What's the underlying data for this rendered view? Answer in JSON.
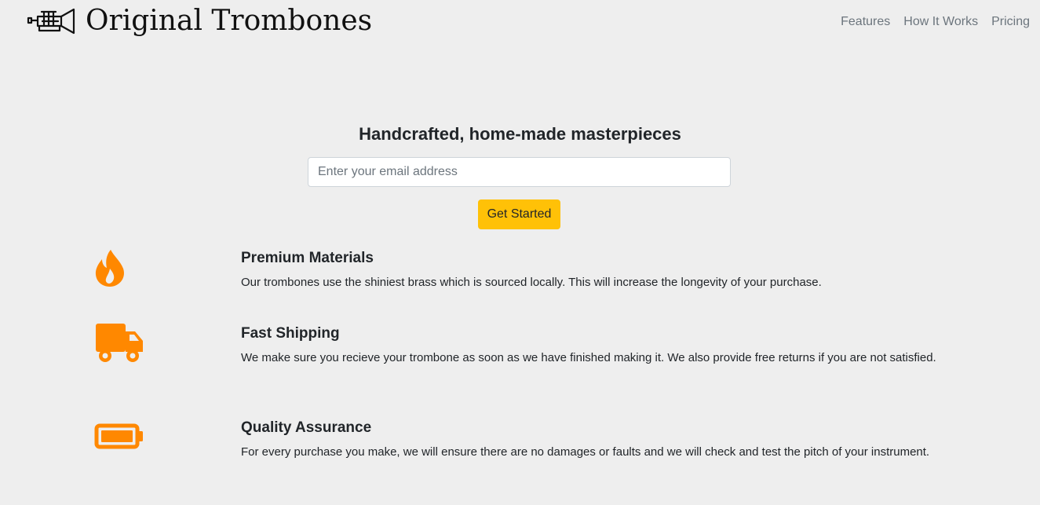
{
  "header": {
    "brand_name": "Original Trombones",
    "logo_icon": "trumpet-icon",
    "nav": [
      {
        "label": "Features"
      },
      {
        "label": "How It Works"
      },
      {
        "label": "Pricing"
      }
    ]
  },
  "hero": {
    "title": "Handcrafted, home-made masterpieces",
    "email_placeholder": "Enter your email address",
    "email_value": "",
    "cta_label": "Get Started"
  },
  "features": [
    {
      "icon": "fire-icon",
      "title": "Premium Materials",
      "text": "Our trombones use the shiniest brass which is sourced locally. This will increase the longevity of your purchase."
    },
    {
      "icon": "truck-icon",
      "title": "Fast Shipping",
      "text": "We make sure you recieve your trombone as soon as we have finished making it. We also provide free returns if you are not satisfied."
    },
    {
      "icon": "battery-icon",
      "title": "Quality Assurance",
      "text": "For every purchase you make, we will ensure there are no damages or faults and we will check and test the pitch of your instrument."
    }
  ],
  "colors": {
    "background": "#eeeeee",
    "accent_icon": "#ff8800",
    "cta_background": "#ffc107",
    "nav_text": "#6c757d"
  }
}
